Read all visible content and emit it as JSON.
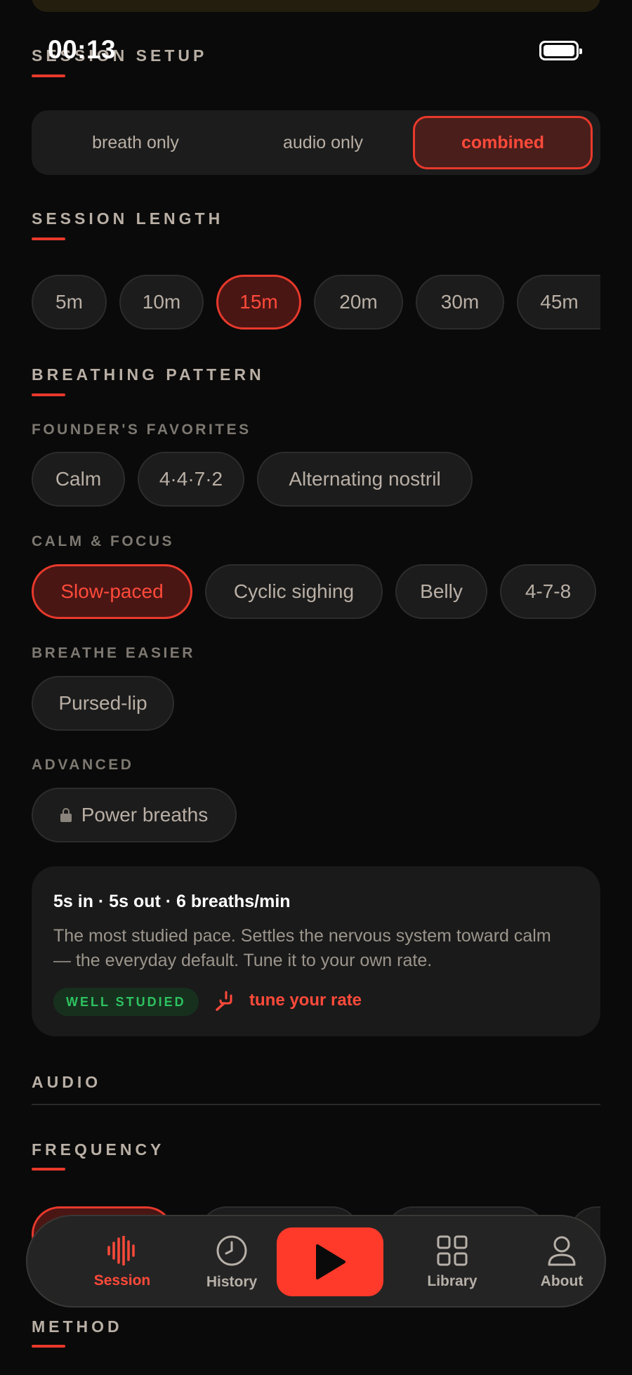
{
  "status": {
    "time": "00:13"
  },
  "setup": {
    "title": "SESSION SETUP",
    "modes": [
      {
        "label": "breath only",
        "active": false
      },
      {
        "label": "audio only",
        "active": false
      },
      {
        "label": "combined",
        "active": true
      }
    ]
  },
  "length": {
    "title": "SESSION LENGTH",
    "options": [
      {
        "label": "5m",
        "active": false
      },
      {
        "label": "10m",
        "active": false
      },
      {
        "label": "15m",
        "active": true
      },
      {
        "label": "20m",
        "active": false
      },
      {
        "label": "30m",
        "active": false
      },
      {
        "label": "45m",
        "active": false
      }
    ]
  },
  "breathing": {
    "title": "BREATHING PATTERN",
    "groups": [
      {
        "title": "FOUNDER'S FAVORITES",
        "items": [
          "Calm",
          "4·4·7·2",
          "Alternating nostril"
        ]
      },
      {
        "title": "CALM & FOCUS",
        "items": [
          "Slow-paced",
          "Cyclic sighing",
          "Belly",
          "4-7-8"
        ],
        "active_item": "Slow-paced"
      },
      {
        "title": "BREATHE EASIER",
        "items": [
          "Pursed-lip"
        ]
      },
      {
        "title": "ADVANCED",
        "items": [
          "Power breaths"
        ],
        "locked_item": "Power breaths"
      }
    ]
  },
  "info": {
    "title": "5s in · 5s out · 6 breaths/min",
    "description": "The most studied pace. Settles the nervous system toward calm — the everyday default. Tune it to your own rate.",
    "badge": "WELL STUDIED",
    "tune_link": "tune your rate",
    "tune_icon": "tuning-fork-icon"
  },
  "audio": {
    "title": "AUDIO"
  },
  "frequency": {
    "title": "FREQUENCY"
  },
  "method": {
    "title": "METHOD"
  },
  "tabbar": {
    "items": [
      {
        "label": "Session",
        "icon": "waveform-icon",
        "active": true
      },
      {
        "label": "History",
        "icon": "clock-icon",
        "active": false
      },
      {
        "label": "",
        "icon": "play-icon",
        "active": false
      },
      {
        "label": "Library",
        "icon": "grid-icon",
        "active": false
      },
      {
        "label": "About",
        "icon": "person-icon",
        "active": false
      }
    ]
  },
  "colors": {
    "accent": "#e8392c",
    "background": "#0a0a0a",
    "badge_green": "#2ec260"
  }
}
